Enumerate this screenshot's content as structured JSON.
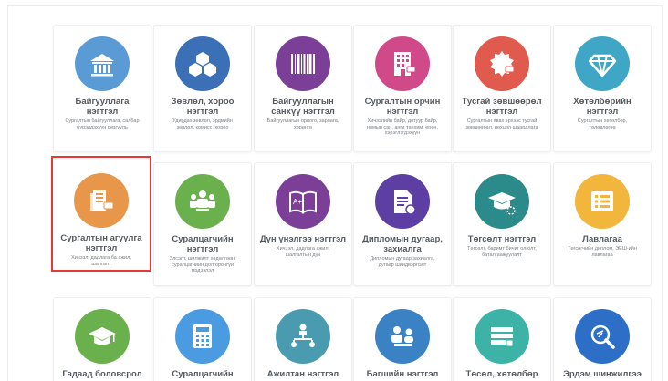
{
  "tiles": [
    {
      "title": "Байгууллага\nнэгтгэл",
      "desc": "Сургалтын байгууллага, салбар\nбүрэлдэхүүн сургууль",
      "color": "#5b9bd5",
      "icon": "institution-icon"
    },
    {
      "title": "Зөвлөл, хороо\nнэгтгэл",
      "desc": "Удирдах зөвлөл, эрдмийн\nзөвлөл, комисс, хороо",
      "color": "#3b6fb6",
      "icon": "cubes-icon"
    },
    {
      "title": "Байгууллагын\nсанхүү нэгтгэл",
      "desc": "Байгууллагын орлого, зарлага,\nхөрөнгө",
      "color": "#7b3f98",
      "icon": "barcode-icon"
    },
    {
      "title": "Сургалтын орчин\nнэгтгэл",
      "desc": "Хичээлийн байр, дотуур байр,\nномын сан, анги танхим, ерөн,\nхэрэглэгдэхүүн",
      "color": "#d04a8a",
      "icon": "building-icon"
    },
    {
      "title": "Тусгай зөвшөөрөл\nнэгтгэл",
      "desc": "Сургалтын явах эрхээс тусгай\nзөвшөөрөл, нөхцөл шаардлага",
      "color": "#e05a4e",
      "icon": "certificate-icon"
    },
    {
      "title": "Хөтөлбөрийн\nнэгтгэл",
      "desc": "Сургалтын хөтөлбөр,\nтөлөвлөгөө",
      "color": "#3fa6c6",
      "icon": "diamond-icon"
    },
    {
      "title": "Сургалтын агуулга\nнэгтгэл",
      "desc": "Хичээл, дадлага ба ажил,\nшалгалт",
      "color": "#e8964a",
      "icon": "book-icon",
      "selected": true
    },
    {
      "title": "Суралцагчийн\nнэгтгэл",
      "desc": "Элсэлт, шилжилт хөдөлгөөн,\nсуралцагчийн долгоронгүй\nмэдээлэл",
      "color": "#6ab04c",
      "icon": "students-icon"
    },
    {
      "title": "Дүн үнэлгээ нэгтгэл",
      "desc": "Хичээл, дадлага ажил,\nшалгалтын дүн",
      "color": "#7b3f98",
      "icon": "open-book-icon"
    },
    {
      "title": "Дипломын дугаар,\nзахиалга",
      "desc": "Дипломын дугаар захиалга,\nдугаар шийдвэрлэлт",
      "color": "#5d3fa3",
      "icon": "document-icon"
    },
    {
      "title": "Төгсөлт нэгтгэл",
      "desc": "Төгсөлт, баримт бичиг олголт,\nбаталгаажуулалт",
      "color": "#2b8a8a",
      "icon": "graduation-icon"
    },
    {
      "title": "Лавлагаа",
      "desc": "Төгсөгчийн диплом, ЭЕШ-ийн\nлавлагаа",
      "color": "#f2b63c",
      "icon": "list-icon"
    },
    {
      "title": "Гадаад боловсрол\nнэгтгэл",
      "desc": "",
      "color": "#6ab04c",
      "icon": "graduation-cap-icon"
    },
    {
      "title": "Суралцагчийн\nсанхүү нэгтгэл",
      "desc": "",
      "color": "#4a9be0",
      "icon": "calculator-icon"
    },
    {
      "title": "Ажилтан нэгтгэл",
      "desc": "",
      "color": "#4a9bb0",
      "icon": "org-chart-icon"
    },
    {
      "title": "Багшийн нэгтгэл",
      "desc": "",
      "color": "#3b82c4",
      "icon": "teachers-icon"
    },
    {
      "title": "Төсөл, хөтөлбөр\nнэгтгэл",
      "desc": "",
      "color": "#3db3a8",
      "icon": "project-icon"
    },
    {
      "title": "Эрдэм шинжилгээ\nнэгтгэл",
      "desc": "",
      "color": "#2d6fc7",
      "icon": "research-icon"
    }
  ]
}
